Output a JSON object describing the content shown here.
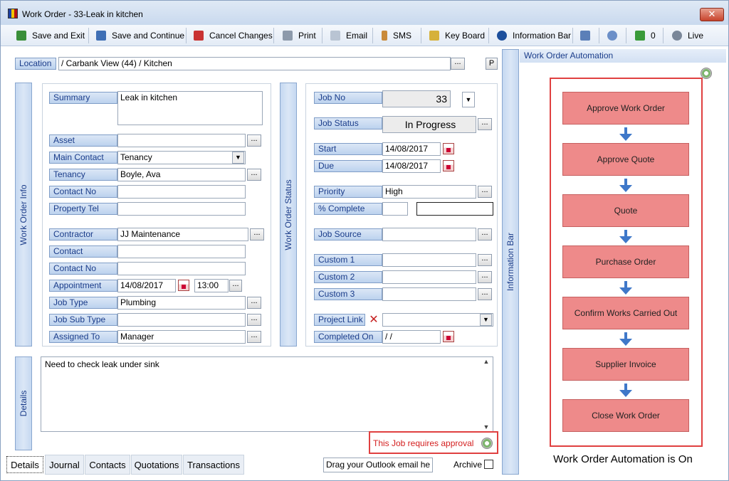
{
  "window": {
    "title": "Work Order -  33-Leak in kitchen"
  },
  "toolbar": {
    "save_exit": "Save and Exit",
    "save_continue": "Save and Continue",
    "cancel": "Cancel Changes",
    "print": "Print",
    "email": "Email",
    "sms": "SMS",
    "keyboard": "Key Board",
    "info_bar": "Information Bar",
    "approvals_count": "0",
    "live": "Live"
  },
  "location": {
    "label": "Location",
    "value": "/ Carbank View (44) / Kitchen",
    "p_button": "P"
  },
  "info": {
    "tab": "Work Order Info",
    "summary_label": "Summary",
    "summary": "Leak in kitchen",
    "asset_label": "Asset",
    "asset": "",
    "main_contact_label": "Main Contact",
    "main_contact": "Tenancy",
    "tenancy_label": "Tenancy",
    "tenancy": "Boyle, Ava",
    "contact_no_label": "Contact No",
    "contact_no": "",
    "property_tel_label": "Property Tel",
    "property_tel": "",
    "contractor_label": "Contractor",
    "contractor": "JJ Maintenance",
    "contact_label": "Contact",
    "contact": "",
    "contact_no2_label": "Contact No",
    "contact_no2": "",
    "appointment_label": "Appointment",
    "appointment_date": "14/08/2017",
    "appointment_time": "13:00",
    "job_type_label": "Job Type",
    "job_type": "Plumbing",
    "job_sub_type_label": "Job  Sub Type",
    "job_sub_type": "",
    "assigned_to_label": "Assigned To",
    "assigned_to": "Manager"
  },
  "status": {
    "tab": "Work Order Status",
    "job_no_label": "Job No",
    "job_no": "33",
    "job_status_label": "Job Status",
    "job_status": "In Progress",
    "start_label": "Start",
    "start": "14/08/2017",
    "due_label": "Due",
    "due": "14/08/2017",
    "priority_label": "Priority",
    "priority": "High",
    "complete_label": "% Complete",
    "complete": "",
    "job_source_label": "Job Source",
    "job_source": "",
    "custom1_label": "Custom 1",
    "custom1": "",
    "custom2_label": "Custom 2",
    "custom2": "",
    "custom3_label": "Custom 3",
    "custom3": "",
    "project_link_label": "Project Link",
    "project_link": "",
    "completed_on_label": "Completed On",
    "completed_on": " / /"
  },
  "details": {
    "tab": "Details",
    "text": "Need to check leak under sink",
    "approval_notice": "This Job requires approval"
  },
  "bottom_tabs": [
    "Details",
    "Journal",
    "Contacts",
    "Quotations",
    "Transactions"
  ],
  "outlook_drop": "Drag your Outlook email he",
  "archive_label": "Archive",
  "info_bar": {
    "side_label": "Information Bar",
    "header": "Work Order Automation",
    "steps": [
      "Approve Work Order",
      "Approve Quote",
      "Quote",
      "Purchase Order",
      "Confirm Works Carried Out",
      "Supplier Invoice",
      "Close Work Order"
    ],
    "footer": "Work Order Automation is On"
  },
  "colors": {
    "step_fill": "#ee8a8a",
    "highlight_border": "#e04040",
    "arrow": "#3f78c9"
  }
}
